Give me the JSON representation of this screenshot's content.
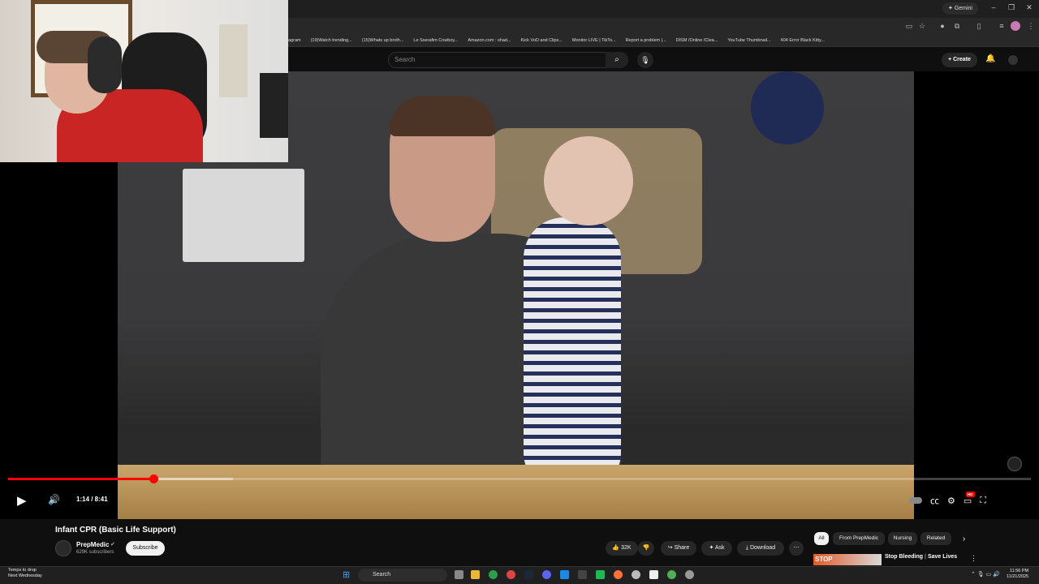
{
  "browser": {
    "gemini_label": "Gemini",
    "bookmarks": [
      "agram",
      "(19)Watch trending...",
      "(15)Whats up broth...",
      "Le Sserafim Cowboy...",
      "Amazon.com : shad...",
      "Kick VoD and Clips...",
      "Monitor LIVE | TikTo...",
      "Report a problem |...",
      "DISM /Online /Clea...",
      "YouTube Thumbnail...",
      "404 Error Black Kitty..."
    ]
  },
  "header": {
    "search_placeholder": "Search",
    "create_label": "Create"
  },
  "player": {
    "time_current": "1:14",
    "time_total": "8:41",
    "time_display": "1:14 / 8:41",
    "progress_fraction": 0.142,
    "buffered_fraction": 0.22,
    "settings_badge": "HD"
  },
  "video": {
    "title": "Infant CPR (Basic Life Support)",
    "channel_name": "PrepMedic",
    "channel_subs": "629K subscribers",
    "subscribe_label": "Subscribe",
    "like_count": "32K",
    "share_label": "Share",
    "ask_label": "Ask",
    "download_label": "Download"
  },
  "related": {
    "chips": [
      "All",
      "From PrepMedic",
      "Nursing",
      "Related"
    ],
    "first_title": "Stop Bleeding",
    "first_title_2": "Save Lives",
    "thumb_text": "STOP"
  },
  "taskbar": {
    "weather_line1": "Temps to drop",
    "weather_line2": "Next Wednesday",
    "search_label": "Search",
    "time": "11:56 PM",
    "date": "11/21/2025"
  },
  "colors": {
    "accent_red": "#ff0000",
    "bg": "#0f0f0f",
    "chip_bg": "#272727"
  }
}
